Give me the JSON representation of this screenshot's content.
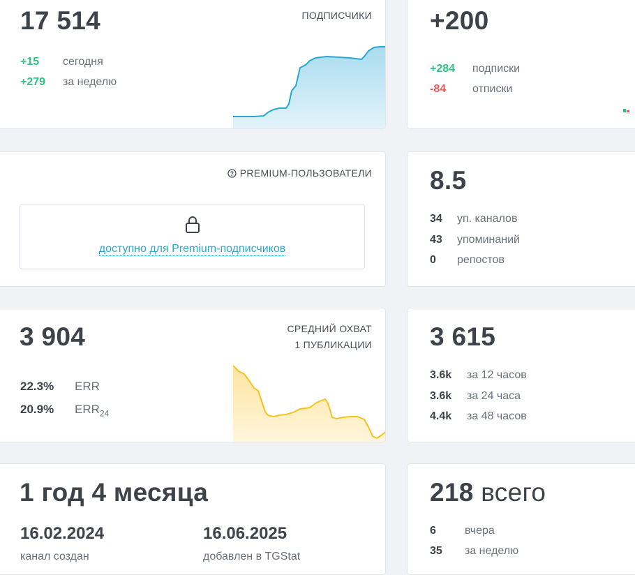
{
  "subscribers": {
    "value": "17 514",
    "caption": "ПОДПИСЧИКИ",
    "rows": [
      {
        "num": "+15",
        "label": "сегодня"
      },
      {
        "num": "+279",
        "label": "за неделю"
      }
    ]
  },
  "growth": {
    "value": "+200",
    "rows": [
      {
        "num": "+284",
        "label": "подписки"
      },
      {
        "num": "-84",
        "label": "отписки"
      }
    ]
  },
  "premium": {
    "caption": "PREMIUM-ПОЛЬЗОВАТЕЛИ",
    "link": "доступно для Premium-подписчиков"
  },
  "citation": {
    "value": "8.5",
    "rows": [
      {
        "num": "34",
        "label": "уп. каналов"
      },
      {
        "num": "43",
        "label": "упоминаний"
      },
      {
        "num": "0",
        "label": "репостов"
      }
    ]
  },
  "reach": {
    "value": "3 904",
    "caption_line1": "СРЕДНИЙ ОХВАТ",
    "caption_line2": "1 ПУБЛИКАЦИИ",
    "rows": [
      {
        "num": "22.3%",
        "label": "ERR",
        "sub": ""
      },
      {
        "num": "20.9%",
        "label": "ERR",
        "sub": "24"
      }
    ]
  },
  "views": {
    "value": "3 615",
    "rows": [
      {
        "num": "3.6k",
        "label": "за 12 часов"
      },
      {
        "num": "3.6k",
        "label": "за 24 часа"
      },
      {
        "num": "4.4k",
        "label": "за 48 часов"
      }
    ]
  },
  "age": {
    "value": "1 год 4 месяца",
    "created_date": "16.02.2024",
    "created_label": "канал создан",
    "added_date": "16.06.2025",
    "added_label": "добавлен в TGStat"
  },
  "posts": {
    "value": "218",
    "value_suffix": "всего",
    "rows": [
      {
        "num": "6",
        "label": "вчера"
      },
      {
        "num": "35",
        "label": "за неделю"
      }
    ]
  },
  "icons": {
    "lock": "lock-icon",
    "info": "info-circle-icon"
  },
  "colors": {
    "positive": "#2fc187",
    "negative": "#ec5b5b",
    "subscribers_line": "#29a8cf",
    "reach_line": "#f6c21c",
    "link": "#2da7c9"
  }
}
